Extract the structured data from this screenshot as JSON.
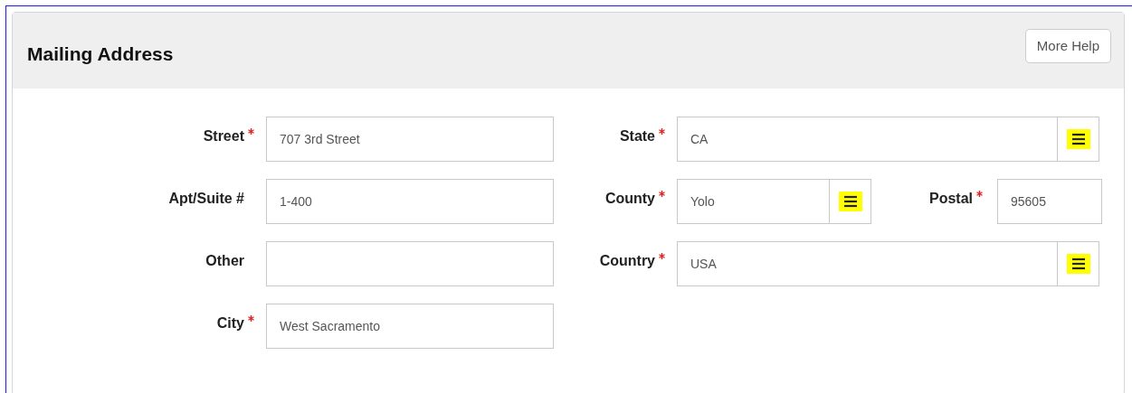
{
  "panel": {
    "title": "Mailing Address",
    "help_button": "More Help"
  },
  "left_fields": [
    {
      "label": "Street",
      "required": true,
      "kind": "text",
      "value": "707 3rd Street"
    },
    {
      "label": "Apt/Suite #",
      "required": false,
      "kind": "text",
      "value": "1-400"
    },
    {
      "label": "Other",
      "required": false,
      "kind": "text"
    },
    {
      "label": "City",
      "required": true,
      "kind": "text",
      "value": "West Sacramento"
    }
  ],
  "right_rows": [
    [
      {
        "label": "State",
        "required": true,
        "kind": "lookup",
        "value": "CA"
      }
    ],
    [
      {
        "label": "County",
        "required": true,
        "kind": "lookup",
        "value": "Yolo"
      },
      {
        "label": "Postal",
        "required": true,
        "kind": "text",
        "value": "95605"
      }
    ],
    [
      {
        "label": "Country",
        "required": true,
        "kind": "lookup",
        "value": "USA"
      }
    ]
  ]
}
